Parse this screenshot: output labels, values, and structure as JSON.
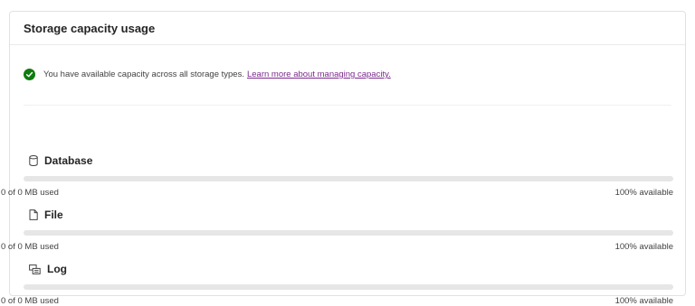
{
  "card": {
    "title": "Storage capacity usage"
  },
  "notice": {
    "icon": "check-circle-icon",
    "icon_color": "#107c10",
    "text": "You have available capacity across all storage types.",
    "link_text": "Learn more about managing capacity.",
    "link_color": "#7b2a8c"
  },
  "sections": [
    {
      "name": "Database",
      "icon": "database-icon",
      "used_text": "0 of 0 MB used",
      "available_text": "100% available",
      "used_fraction": 0
    },
    {
      "name": "File",
      "icon": "file-icon",
      "used_text": "0 of 0 MB used",
      "available_text": "100% available",
      "used_fraction": 0
    },
    {
      "name": "Log",
      "icon": "log-icon",
      "used_text": "0 of 0 MB used",
      "available_text": "100% available",
      "used_fraction": 0
    }
  ]
}
